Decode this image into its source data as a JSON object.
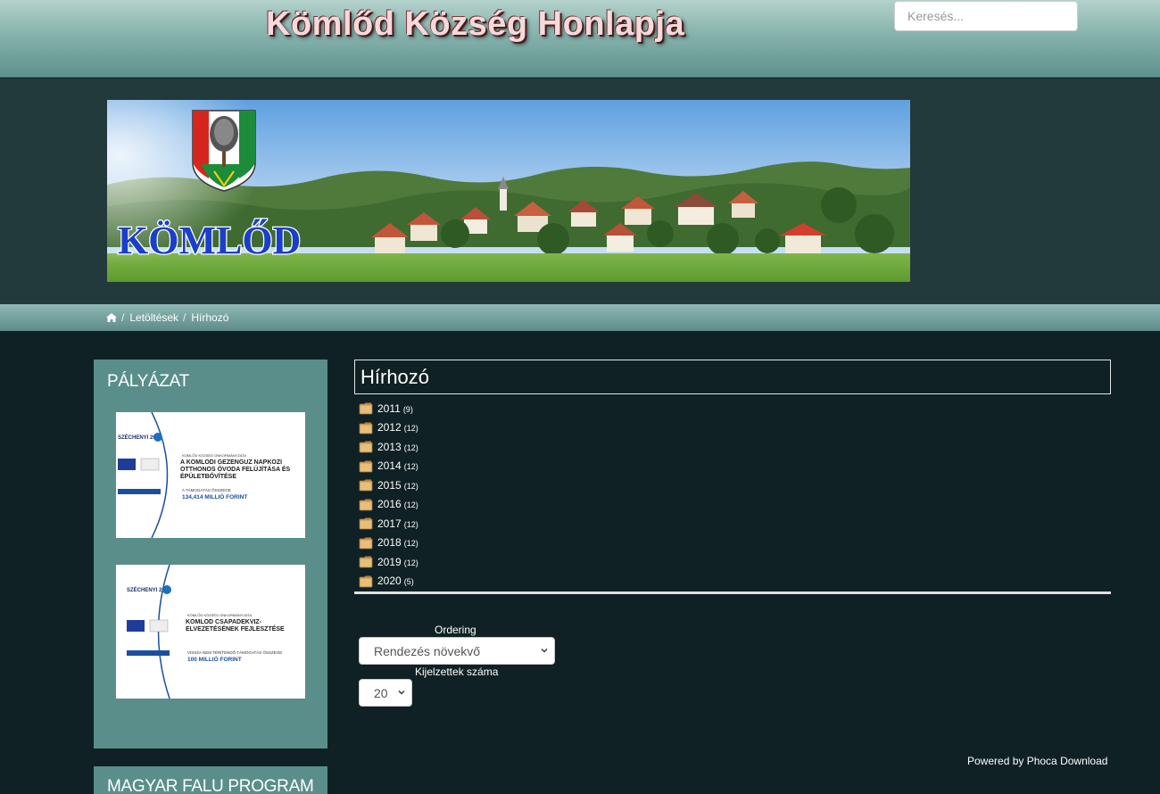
{
  "header": {
    "site_title": "Kömlőd Község Honlapja",
    "search_placeholder": "Keresés..."
  },
  "banner": {
    "town_name": "KÖMLŐD"
  },
  "breadcrumb": {
    "home_icon": "home-icon",
    "items": [
      "Letöltések",
      "Hírhozó"
    ],
    "separator": "/"
  },
  "sidebar": {
    "module1_title": "PÁLYÁZAT",
    "module2_title": "MAGYAR FALU PROGRAM",
    "grant1": {
      "program": "SZÉCHENYI 2020",
      "beneficiary": "KÖMLŐD KÖZSÉG ÖNKORMÁNYZATA",
      "project": "A KÖMLŐDI GÉZENGÚZ NAPKÖZI OTTHONOS ÓVODA FELÚJÍTÁSA ÉS ÉPÜLETBŐVÍTÉSE",
      "amount_label": "A TÁMOGATÁS ÖSSZEGE",
      "amount": "134,414 MILLIÓ FORINT"
    },
    "grant2": {
      "program": "SZÉCHENYI 2020",
      "beneficiary": "KÖMLŐD KÖZSÉG ÖNKORMÁNYZATA",
      "project": "KÖMLŐD CSAPADÉKVÍZ-ELVEZETÉSÉNEK FEJLESZTÉSE",
      "amount_label": "VISSZA NEM TÉRÍTENDŐ TÁMOGATÁS ÖSSZEGE",
      "amount": "100 MILLIÓ FORINT"
    }
  },
  "main": {
    "title": "Hírhozó",
    "categories": [
      {
        "label": "2011",
        "count": "(9)"
      },
      {
        "label": "2012",
        "count": "(12)"
      },
      {
        "label": "2013",
        "count": "(12)"
      },
      {
        "label": "2014",
        "count": "(12)"
      },
      {
        "label": "2015",
        "count": "(12)"
      },
      {
        "label": "2016",
        "count": "(12)"
      },
      {
        "label": "2017",
        "count": "(12)"
      },
      {
        "label": "2018",
        "count": "(12)"
      },
      {
        "label": "2019",
        "count": "(12)"
      },
      {
        "label": "2020",
        "count": "(5)"
      }
    ],
    "ordering_label": "Ordering",
    "ordering_value": "Rendezés növekvő",
    "limit_label": "Kijelzettek száma",
    "limit_value": "20",
    "powered_by": "Powered by Phoca Download"
  },
  "colors": {
    "header_gradient": "#86b2ac",
    "body_bg": "#0f2124",
    "banner_bg": "#223a3b",
    "sidebar_bg": "#5a8e8a",
    "folder": "#d9a75c"
  }
}
